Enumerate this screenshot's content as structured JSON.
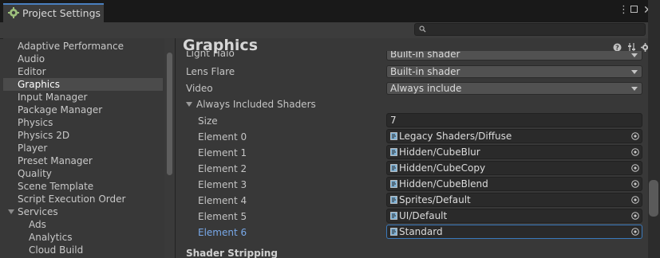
{
  "window": {
    "title": "Project Settings",
    "menu_icon": "kebab-menu-icon",
    "maximize_icon": "maximize-icon",
    "close_icon": "close-icon"
  },
  "search": {
    "placeholder": "",
    "icon": "search-icon"
  },
  "sidebar": {
    "items": [
      {
        "label": "Adaptive Performance"
      },
      {
        "label": "Audio"
      },
      {
        "label": "Editor"
      },
      {
        "label": "Graphics",
        "selected": true
      },
      {
        "label": "Input Manager"
      },
      {
        "label": "Package Manager"
      },
      {
        "label": "Physics"
      },
      {
        "label": "Physics 2D"
      },
      {
        "label": "Player"
      },
      {
        "label": "Preset Manager"
      },
      {
        "label": "Quality"
      },
      {
        "label": "Scene Template"
      },
      {
        "label": "Script Execution Order"
      },
      {
        "label": "Services",
        "expanded": true
      },
      {
        "label": "Ads"
      },
      {
        "label": "Analytics"
      },
      {
        "label": "Cloud Build"
      }
    ]
  },
  "main": {
    "title": "Graphics",
    "header_icons": [
      "help-icon",
      "presets-icon",
      "settings-icon"
    ],
    "rows": {
      "light_halo": {
        "label": "Light Halo",
        "value": "Built-in shader"
      },
      "lens_flare": {
        "label": "Lens Flare",
        "value": "Built-in shader"
      },
      "video": {
        "label": "Video",
        "value": "Always include"
      }
    },
    "always_included": {
      "label": "Always Included Shaders",
      "size_label": "Size",
      "size_value": "7",
      "elements": [
        {
          "label": "Element 0",
          "value": "Legacy Shaders/Diffuse"
        },
        {
          "label": "Element 1",
          "value": "Hidden/CubeBlur"
        },
        {
          "label": "Element 2",
          "value": "Hidden/CubeCopy"
        },
        {
          "label": "Element 3",
          "value": "Hidden/CubeBlend"
        },
        {
          "label": "Element 4",
          "value": "Sprites/Default"
        },
        {
          "label": "Element 5",
          "value": "UI/Default"
        },
        {
          "label": "Element 6",
          "value": "Standard",
          "focused": true
        }
      ]
    },
    "next_section": "Shader Stripping"
  },
  "colors": {
    "accent": "#3a79bb",
    "selected_label": "#78a8e8",
    "tab_accent": "#4a7fbf"
  }
}
